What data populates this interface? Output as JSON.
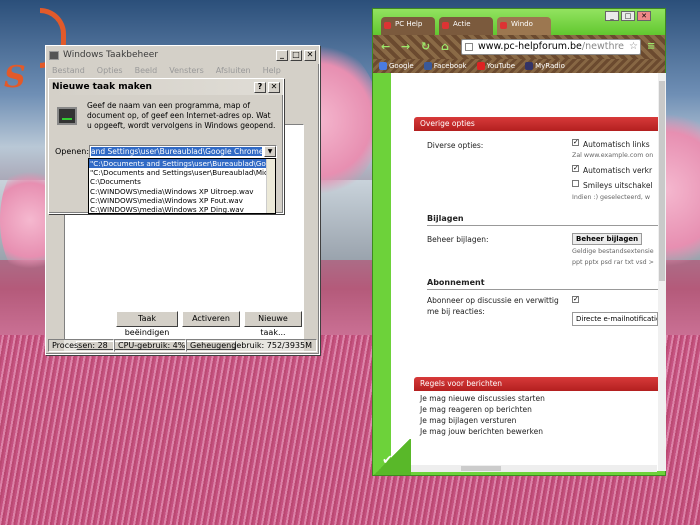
{
  "taskmanager": {
    "title": "Windows Taakbeheer",
    "menu": [
      "Bestand",
      "Opties",
      "Beeld",
      "Vensters",
      "Afsluiten",
      "Help"
    ],
    "buttons": {
      "end_task": "Taak beëindigen",
      "activate": "Activeren",
      "new_task": "Nieuwe taak..."
    },
    "status": {
      "processes": "Processen: 28",
      "cpu": "CPU-gebruik: 4%",
      "memory": "Geheugengebruik: 752/3935M"
    }
  },
  "run_dialog": {
    "title": "Nieuwe taak maken",
    "description": "Geef de naam van een programma, map of document op, of geef een Internet-adres op. Wat u opgeeft, wordt vervolgens in Windows geopend.",
    "open_label": "Openen:",
    "open_value": "and Settings\\user\\Bureaublad\\Google Chrome.lnk\"",
    "options": [
      "\"C:\\Documents and Settings\\user\\Bureaublad\\Google",
      "\"C:\\Documents and Settings\\user\\Bureaublad\\Microsc",
      "C:\\Documents",
      "C:\\WINDOWS\\media\\Windows XP Uitroep.wav",
      "C:\\WINDOWS\\media\\Windows XP Fout.wav",
      "C:\\WINDOWS\\media\\Windows XP Ding.wav"
    ],
    "help_btn": "?",
    "close_btn": "✕"
  },
  "chrome": {
    "tabs": [
      "PC Help",
      "Actie",
      "Windo"
    ],
    "url_host": "www.pc-helpforum.be",
    "url_path": "/newthre",
    "bookmarks": [
      {
        "label": "Google",
        "color": "#4a7be0"
      },
      {
        "label": "Facebook",
        "color": "#3b5998"
      },
      {
        "label": "YouTube",
        "color": "#d22"
      },
      {
        "label": "MyRadio",
        "color": "#336"
      }
    ],
    "page": {
      "other_options_title": "Overige opties",
      "misc_label": "Diverse opties:",
      "auto_links": "Automatisch links",
      "auto_links_note": "Zal www.example.com on",
      "auto_verkr": "Automatisch verkr",
      "smileys": "Smileys uitschakel",
      "smileys_note": "Indien :) geselecteerd, w",
      "attachments_heading": "Bijlagen",
      "manage_attachments_label": "Beheer bijlagen:",
      "manage_attachments_btn": "Beheer bijlagen",
      "attachments_note1": "Geldige bestandsextensie",
      "attachments_note2": "ppt pptx psd rar txt vsd >",
      "subscription_heading": "Abonnement",
      "subscribe_label": "Abonneer op discussie en verwittig me bij reacties:",
      "notify_select": "Directe e-mailnotificatie",
      "rules_title": "Regels voor berichten",
      "rules": [
        "Je mag nieuwe discussies starten",
        "Je mag reageren op berichten",
        "Je mag bijlagen versturen",
        "Je mag jouw berichten bewerken"
      ]
    }
  }
}
